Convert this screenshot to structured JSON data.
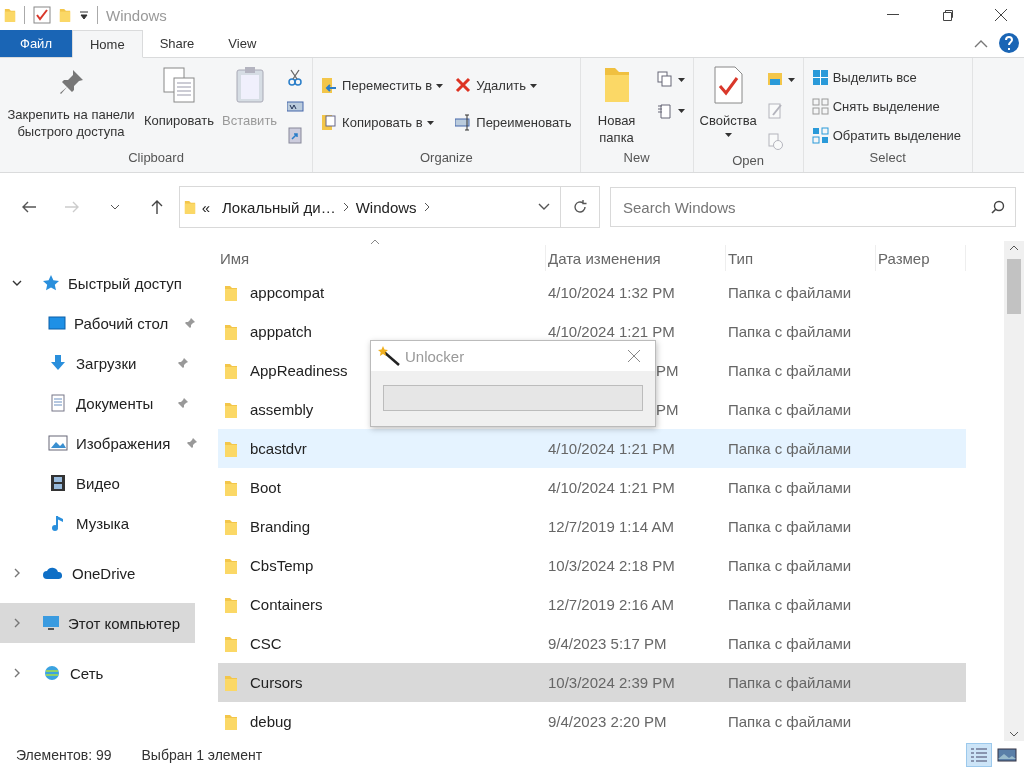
{
  "title_bar": {
    "title": "Windows"
  },
  "ribbon": {
    "tabs": [
      {
        "label": "Файл",
        "kind": "file",
        "selected": false
      },
      {
        "label": "Home",
        "kind": "tab",
        "selected": true
      },
      {
        "label": "Share",
        "kind": "tab",
        "selected": false
      },
      {
        "label": "View",
        "kind": "tab",
        "selected": false
      }
    ],
    "groups": [
      {
        "label": "Clipboard",
        "columns": [
          [
            {
              "label": "Закрепить на панели быстрого доступа",
              "kind": "large",
              "disabled": false,
              "dropdown": false
            }
          ],
          [
            {
              "label": "Копировать",
              "kind": "large",
              "disabled": false,
              "dropdown": false
            }
          ],
          [
            {
              "label": "Вставить",
              "kind": "large",
              "disabled": true,
              "dropdown": false
            }
          ],
          [
            {
              "kind": "icon",
              "disabled": false,
              "dropdown": false
            },
            {
              "kind": "icon",
              "disabled": false,
              "dropdown": false
            },
            {
              "kind": "icon",
              "disabled": false,
              "dropdown": false
            }
          ]
        ]
      },
      {
        "label": "Organize",
        "columns": [
          [
            {
              "label": "Переместить в",
              "kind": "small",
              "disabled": false,
              "dropdown": true
            },
            {
              "label": "Копировать в",
              "kind": "small",
              "disabled": false,
              "dropdown": true
            }
          ],
          [
            {
              "label": "Удалить",
              "kind": "small",
              "disabled": false,
              "dropdown": true
            },
            {
              "label": "Переименовать",
              "kind": "small",
              "disabled": false,
              "dropdown": false
            }
          ]
        ]
      },
      {
        "label": "New",
        "columns": [
          [
            {
              "label": "Новая папка",
              "kind": "large",
              "disabled": false,
              "dropdown": false
            }
          ],
          [
            {
              "kind": "icon",
              "disabled": false,
              "dropdown": true
            },
            {
              "kind": "icon",
              "disabled": false,
              "dropdown": true
            }
          ]
        ]
      },
      {
        "label": "Open",
        "columns": [
          [
            {
              "label": "Свойства",
              "kind": "large",
              "disabled": false,
              "dropdown": true
            }
          ],
          [
            {
              "kind": "icon",
              "disabled": false,
              "dropdown": true
            },
            {
              "kind": "icon",
              "disabled": true,
              "dropdown": false
            },
            {
              "kind": "icon",
              "disabled": true,
              "dropdown": false
            }
          ]
        ]
      },
      {
        "label": "Select",
        "columns": [
          [
            {
              "label": "Выделить все",
              "kind": "small",
              "disabled": false,
              "dropdown": false
            },
            {
              "label": "Снять выделение",
              "kind": "small",
              "disabled": false,
              "dropdown": false
            },
            {
              "label": "Обратить выделение",
              "kind": "small",
              "disabled": false,
              "dropdown": false
            }
          ]
        ]
      }
    ]
  },
  "navigation": {
    "back_disabled": false,
    "forward_disabled": true,
    "breadcrumb": [
      "«",
      "Локальный ди…",
      "Windows"
    ],
    "search": {
      "placeholder": "Search Windows"
    }
  },
  "sidebar": {
    "items": [
      {
        "label": "Быстрый доступ",
        "expanded": true,
        "selected": false,
        "children": [
          {
            "label": "Рабочий стол",
            "pinned": true,
            "selected": false
          },
          {
            "label": "Загрузки",
            "pinned": true,
            "selected": false
          },
          {
            "label": "Документы",
            "pinned": true,
            "selected": false
          },
          {
            "label": "Изображения",
            "pinned": true,
            "selected": false
          },
          {
            "label": "Видео",
            "pinned": false,
            "selected": false
          },
          {
            "label": "Музыка",
            "pinned": false,
            "selected": false
          }
        ]
      },
      {
        "label": "OneDrive",
        "expanded": false,
        "selected": false
      },
      {
        "label": "Этот компьютер",
        "expanded": false,
        "selected": true
      },
      {
        "label": "Сеть",
        "expanded": false,
        "selected": false
      }
    ]
  },
  "table": {
    "columns": [
      "Имя",
      "Дата изменения",
      "Тип",
      "Размер"
    ],
    "rows": [
      {
        "name": "appcompat",
        "date": "4/10/2024 1:32 PM",
        "type": "Папка с файлами",
        "selected": false,
        "hovered": false,
        "covered": false
      },
      {
        "name": "apppatch",
        "date": "4/10/2024 1:21 PM",
        "type": "Папка с файлами",
        "selected": false,
        "hovered": false,
        "covered": false
      },
      {
        "name": "AppReadiness",
        "date": "PM",
        "type": "Папка с файлами",
        "selected": false,
        "hovered": false,
        "covered": true
      },
      {
        "name": "assembly",
        "date": "PM",
        "type": "Папка с файлами",
        "selected": false,
        "hovered": false,
        "covered": true
      },
      {
        "name": "bcastdvr",
        "date": "4/10/2024 1:21 PM",
        "type": "Папка с файлами",
        "selected": false,
        "hovered": true,
        "covered": false
      },
      {
        "name": "Boot",
        "date": "4/10/2024 1:21 PM",
        "type": "Папка с файлами",
        "selected": false,
        "hovered": false,
        "covered": false
      },
      {
        "name": "Branding",
        "date": "12/7/2019 1:14 AM",
        "type": "Папка с файлами",
        "selected": false,
        "hovered": false,
        "covered": false
      },
      {
        "name": "CbsTemp",
        "date": "10/3/2024 2:18 PM",
        "type": "Папка с файлами",
        "selected": false,
        "hovered": false,
        "covered": false
      },
      {
        "name": "Containers",
        "date": "12/7/2019 2:16 AM",
        "type": "Папка с файлами",
        "selected": false,
        "hovered": false,
        "covered": false
      },
      {
        "name": "CSC",
        "date": "9/4/2023 5:17 PM",
        "type": "Папка с файлами",
        "selected": false,
        "hovered": false,
        "covered": false
      },
      {
        "name": "Cursors",
        "date": "10/3/2024 2:39 PM",
        "type": "Папка с файлами",
        "selected": true,
        "hovered": false,
        "covered": false
      },
      {
        "name": "debug",
        "date": "9/4/2023 2:20 PM",
        "type": "Папка с файлами",
        "selected": false,
        "hovered": false,
        "covered": false
      }
    ]
  },
  "dialog": {
    "title": "Unlocker",
    "progress": {
      "level": 0
    }
  },
  "status_bar": {
    "count": "Элементов: 99",
    "selection": "Выбран 1 элемент",
    "views": [
      {
        "kind": "details",
        "selected": true
      },
      {
        "kind": "large_icons",
        "selected": false
      }
    ]
  }
}
